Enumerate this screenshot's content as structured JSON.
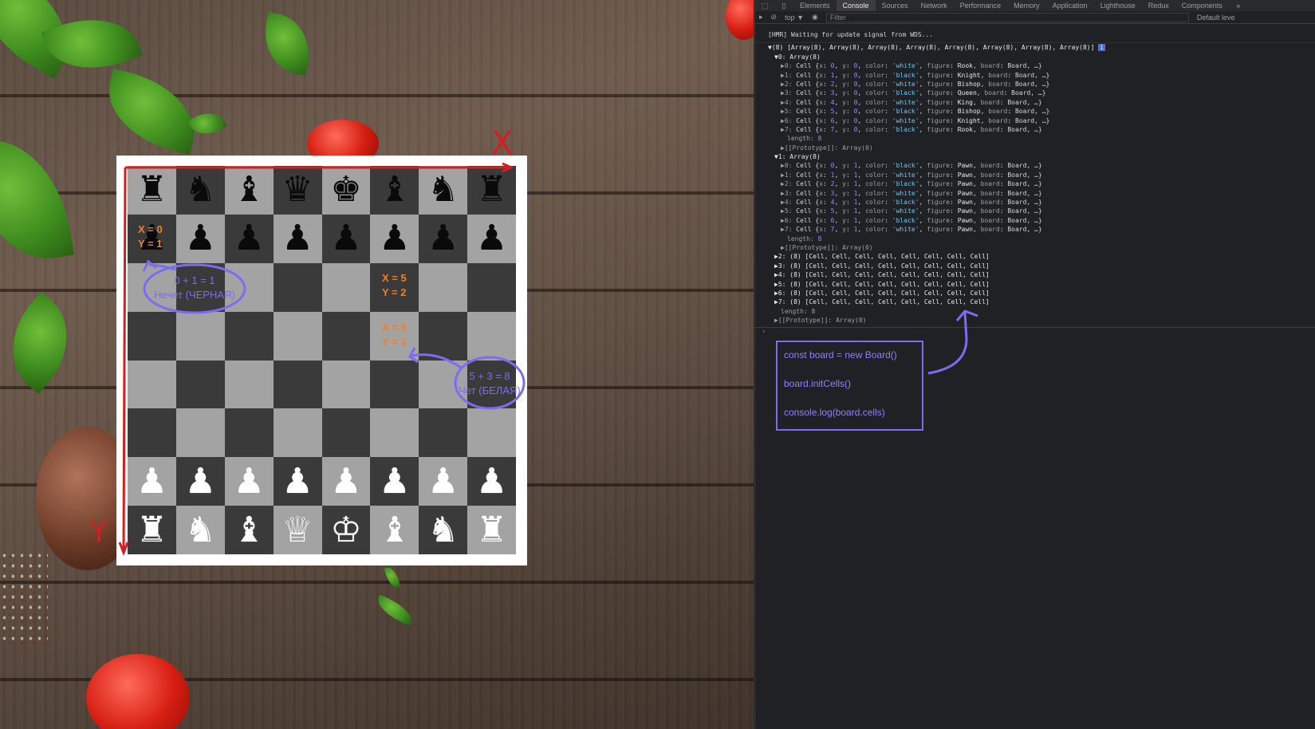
{
  "board": {
    "rows": [
      [
        {
          "p": "♜",
          "c": "b"
        },
        {
          "p": "♞",
          "c": "b"
        },
        {
          "p": "♝",
          "c": "b"
        },
        {
          "p": "♛",
          "c": "b"
        },
        {
          "p": "♚",
          "c": "b"
        },
        {
          "p": "♝",
          "c": "b"
        },
        {
          "p": "♞",
          "c": "b"
        },
        {
          "p": "♜",
          "c": "b"
        }
      ],
      [
        {
          "p": "♟",
          "c": "b"
        },
        {
          "p": "♟",
          "c": "b"
        },
        {
          "p": "♟",
          "c": "b"
        },
        {
          "p": "♟",
          "c": "b"
        },
        {
          "p": "♟",
          "c": "b"
        },
        {
          "p": "♟",
          "c": "b"
        },
        {
          "p": "♟",
          "c": "b"
        },
        {
          "p": "♟",
          "c": "b"
        }
      ],
      [
        {
          "p": "",
          "c": ""
        },
        {
          "p": "",
          "c": ""
        },
        {
          "p": "",
          "c": ""
        },
        {
          "p": "",
          "c": ""
        },
        {
          "p": "",
          "c": ""
        },
        {
          "p": "",
          "c": ""
        },
        {
          "p": "",
          "c": ""
        },
        {
          "p": "",
          "c": ""
        }
      ],
      [
        {
          "p": "",
          "c": ""
        },
        {
          "p": "",
          "c": ""
        },
        {
          "p": "",
          "c": ""
        },
        {
          "p": "",
          "c": ""
        },
        {
          "p": "",
          "c": ""
        },
        {
          "p": "",
          "c": ""
        },
        {
          "p": "",
          "c": ""
        },
        {
          "p": "",
          "c": ""
        }
      ],
      [
        {
          "p": "",
          "c": ""
        },
        {
          "p": "",
          "c": ""
        },
        {
          "p": "",
          "c": ""
        },
        {
          "p": "",
          "c": ""
        },
        {
          "p": "",
          "c": ""
        },
        {
          "p": "",
          "c": ""
        },
        {
          "p": "",
          "c": ""
        },
        {
          "p": "",
          "c": ""
        }
      ],
      [
        {
          "p": "",
          "c": ""
        },
        {
          "p": "",
          "c": ""
        },
        {
          "p": "",
          "c": ""
        },
        {
          "p": "",
          "c": ""
        },
        {
          "p": "",
          "c": ""
        },
        {
          "p": "",
          "c": ""
        },
        {
          "p": "",
          "c": ""
        },
        {
          "p": "",
          "c": ""
        }
      ],
      [
        {
          "p": "♟",
          "c": "w"
        },
        {
          "p": "♟",
          "c": "w"
        },
        {
          "p": "♟",
          "c": "w"
        },
        {
          "p": "♟",
          "c": "w"
        },
        {
          "p": "♟",
          "c": "w"
        },
        {
          "p": "♟",
          "c": "w"
        },
        {
          "p": "♟",
          "c": "w"
        },
        {
          "p": "♟",
          "c": "w"
        }
      ],
      [
        {
          "p": "♜",
          "c": "w"
        },
        {
          "p": "♞",
          "c": "w"
        },
        {
          "p": "♝",
          "c": "w"
        },
        {
          "p": "♕",
          "c": "w"
        },
        {
          "p": "♔",
          "c": "w"
        },
        {
          "p": "♝",
          "c": "w"
        },
        {
          "p": "♞",
          "c": "w"
        },
        {
          "p": "♜",
          "c": "w"
        }
      ]
    ],
    "light_color": "#a3a3a3",
    "dark_color": "#3a3a3a"
  },
  "annotations": {
    "axis_x": "X",
    "axis_y": "Y",
    "cell_a_x": "X = 0",
    "cell_a_y": "Y = 1",
    "cell_b_x": "X = 5",
    "cell_b_y": "Y = 2",
    "cell_c_x": "X = 5",
    "cell_c_y": "Y = 3",
    "sum_odd": "0 + 1 = 1",
    "sum_odd_label": "Нечет (ЧЕРНАЯ)",
    "sum_even": "5 + 3 = 8",
    "sum_even_label": "Чет (БЕЛАЯ)",
    "colors": {
      "orange": "#e8822d",
      "purple": "#7b6cf0",
      "red": "#d41f1f"
    }
  },
  "devtools": {
    "tabs": [
      "Elements",
      "Console",
      "Sources",
      "Network",
      "Performance",
      "Memory",
      "Application",
      "Lighthouse",
      "Redux",
      "Components"
    ],
    "active_tab": "Console",
    "more": "»",
    "context": "top ▼",
    "filter_placeholder": "Filter",
    "levels": "Default leve",
    "hmr": "[HMR] Waiting for update signal from WDS...",
    "summary": "▼(8) [Array(8), Array(8), Array(8), Array(8), Array(8), Array(8), Array(8), Array(8)]",
    "rows": [
      {
        "head": "▼0: Array(8)",
        "cells": [
          {
            "i": "0",
            "x": "0",
            "y": "0",
            "color": "'white'",
            "figure": "Rook"
          },
          {
            "i": "1",
            "x": "1",
            "y": "0",
            "color": "'black'",
            "figure": "Knight"
          },
          {
            "i": "2",
            "x": "2",
            "y": "0",
            "color": "'white'",
            "figure": "Bishop"
          },
          {
            "i": "3",
            "x": "3",
            "y": "0",
            "color": "'black'",
            "figure": "Queen"
          },
          {
            "i": "4",
            "x": "4",
            "y": "0",
            "color": "'white'",
            "figure": "King"
          },
          {
            "i": "5",
            "x": "5",
            "y": "0",
            "color": "'black'",
            "figure": "Bishop"
          },
          {
            "i": "6",
            "x": "6",
            "y": "0",
            "color": "'white'",
            "figure": "Knight"
          },
          {
            "i": "7",
            "x": "7",
            "y": "0",
            "color": "'black'",
            "figure": "Rook"
          }
        ]
      },
      {
        "head": "▼1: Array(8)",
        "cells": [
          {
            "i": "0",
            "x": "0",
            "y": "1",
            "color": "'black'",
            "figure": "Pawn"
          },
          {
            "i": "1",
            "x": "1",
            "y": "1",
            "color": "'white'",
            "figure": "Pawn"
          },
          {
            "i": "2",
            "x": "2",
            "y": "1",
            "color": "'black'",
            "figure": "Pawn"
          },
          {
            "i": "3",
            "x": "3",
            "y": "1",
            "color": "'white'",
            "figure": "Pawn"
          },
          {
            "i": "4",
            "x": "4",
            "y": "1",
            "color": "'black'",
            "figure": "Pawn"
          },
          {
            "i": "5",
            "x": "5",
            "y": "1",
            "color": "'white'",
            "figure": "Pawn"
          },
          {
            "i": "6",
            "x": "6",
            "y": "1",
            "color": "'black'",
            "figure": "Pawn"
          },
          {
            "i": "7",
            "x": "7",
            "y": "1",
            "color": "'white'",
            "figure": "Pawn"
          }
        ]
      }
    ],
    "length_label": "length: 8",
    "proto_label": "▶[[Prototype]]: Array(0)",
    "collapsed": [
      "▶2: (8) [Cell, Cell, Cell, Cell, Cell, Cell, Cell, Cell]",
      "▶3: (8) [Cell, Cell, Cell, Cell, Cell, Cell, Cell, Cell]",
      "▶4: (8) [Cell, Cell, Cell, Cell, Cell, Cell, Cell, Cell]",
      "▶5: (8) [Cell, Cell, Cell, Cell, Cell, Cell, Cell, Cell]",
      "▶6: (8) [Cell, Cell, Cell, Cell, Cell, Cell, Cell, Cell]",
      "▶7: (8) [Cell, Cell, Cell, Cell, Cell, Cell, Cell, Cell]"
    ],
    "prompt": "›",
    "code": [
      "const board = new Board()",
      "board.initCells()",
      "console.log(board.cells)"
    ]
  }
}
